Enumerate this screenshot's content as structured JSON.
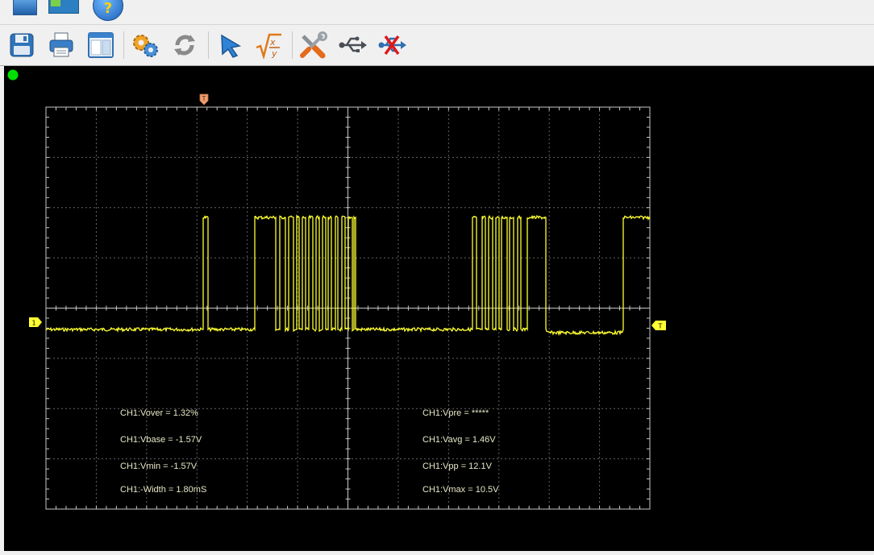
{
  "toolbar": {
    "buttons": [
      {
        "name": "save-button",
        "icon": "floppy-disk-icon"
      },
      {
        "name": "print-button",
        "icon": "printer-icon"
      },
      {
        "name": "window-layout-button",
        "icon": "window-layout-icon"
      },
      {
        "name": "settings-button",
        "icon": "gears-icon"
      },
      {
        "name": "refresh-button",
        "icon": "refresh-icon"
      },
      {
        "name": "cursor-button",
        "icon": "cursor-arrow-icon"
      },
      {
        "name": "math-function-button",
        "icon": "math-fx-icon"
      },
      {
        "name": "tools-button",
        "icon": "wrench-screwdriver-icon"
      },
      {
        "name": "usb-connect-button",
        "icon": "usb-icon"
      },
      {
        "name": "usb-disconnect-button",
        "icon": "usb-disconnect-icon"
      }
    ]
  },
  "status": {
    "run_indicator_color": "#00e000"
  },
  "markers": {
    "trigger_top": "T",
    "channel_level": "1",
    "trigger_level": "T"
  },
  "colors": {
    "trace": "#ffff33",
    "grid": "#c8c8c8",
    "background": "#000000"
  },
  "measurements": {
    "left": [
      "CH1:Vover = 1.32%",
      "CH1:Vbase = -1.57V",
      "CH1:Vmin = -1.57V",
      "CH1:-Width = 1.80mS"
    ],
    "right": [
      "CH1:Vpre = *****",
      "CH1:Vavg = 1.46V",
      "CH1:Vpp = 12.1V",
      "CH1:Vmax = 10.5V"
    ]
  }
}
